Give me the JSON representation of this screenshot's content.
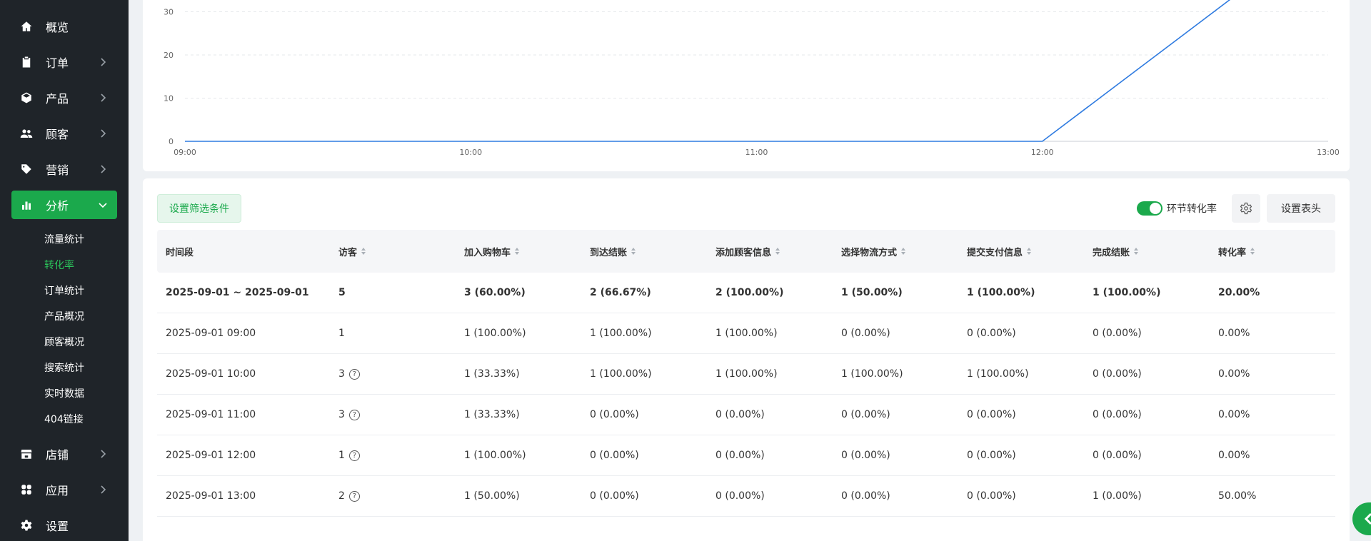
{
  "sidebar": {
    "items": [
      {
        "label": "概览",
        "icon": "home-icon"
      },
      {
        "label": "订单",
        "icon": "clipboard-icon"
      },
      {
        "label": "产品",
        "icon": "box-icon"
      },
      {
        "label": "顾客",
        "icon": "users-icon"
      },
      {
        "label": "营销",
        "icon": "tag-icon"
      },
      {
        "label": "分析",
        "icon": "bar-chart-icon"
      },
      {
        "label": "店铺",
        "icon": "store-icon"
      },
      {
        "label": "应用",
        "icon": "apps-icon"
      },
      {
        "label": "设置",
        "icon": "gear-icon"
      }
    ],
    "sub_items": [
      "流量统计",
      "转化率",
      "订单统计",
      "产品概况",
      "顾客概况",
      "搜索统计",
      "实时数据",
      "404链接"
    ],
    "active_sub": "转化率"
  },
  "chart_data": {
    "type": "line",
    "x": [
      "09:00",
      "10:00",
      "11:00",
      "12:00",
      "13:00"
    ],
    "y_ticks": [
      0,
      10,
      20,
      30
    ],
    "series": [
      {
        "values": [
          0,
          0,
          0,
          0,
          50
        ]
      }
    ],
    "ylim_visible": [
      0,
      30
    ],
    "grid": true,
    "line_color": "#2f7be0"
  },
  "toolbar": {
    "filter_label": "设置筛选条件",
    "toggle_label": "环节转化率",
    "header_label": "设置表头"
  },
  "table": {
    "columns": [
      "时间段",
      "访客",
      "加入购物车",
      "到达结账",
      "添加顾客信息",
      "选择物流方式",
      "提交支付信息",
      "完成结账",
      "转化率"
    ],
    "total": [
      "2025-09-01 ~ 2025-09-01",
      "5",
      "3 (60.00%)",
      "2 (66.67%)",
      "2 (100.00%)",
      "1 (50.00%)",
      "1 (100.00%)",
      "1 (100.00%)",
      "20.00%"
    ],
    "rows": [
      [
        "2025-09-01 09:00",
        "1",
        "1 (100.00%)",
        "1 (100.00%)",
        "1 (100.00%)",
        "0 (0.00%)",
        "0 (0.00%)",
        "0 (0.00%)",
        "0.00%"
      ],
      [
        "2025-09-01 10:00",
        "3",
        "1 (33.33%)",
        "1 (100.00%)",
        "1 (100.00%)",
        "1 (100.00%)",
        "1 (100.00%)",
        "0 (0.00%)",
        "0.00%"
      ],
      [
        "2025-09-01 11:00",
        "3",
        "1 (33.33%)",
        "0 (0.00%)",
        "0 (0.00%)",
        "0 (0.00%)",
        "0 (0.00%)",
        "0 (0.00%)",
        "0.00%"
      ],
      [
        "2025-09-01 12:00",
        "1",
        "1 (100.00%)",
        "0 (0.00%)",
        "0 (0.00%)",
        "0 (0.00%)",
        "0 (0.00%)",
        "0 (0.00%)",
        "0.00%"
      ],
      [
        "2025-09-01 13:00",
        "2",
        "1 (50.00%)",
        "0 (0.00%)",
        "0 (0.00%)",
        "0 (0.00%)",
        "0 (0.00%)",
        "1 (0.00%)",
        "50.00%"
      ]
    ],
    "rows_with_help_icon": [
      false,
      true,
      true,
      true,
      true
    ]
  }
}
